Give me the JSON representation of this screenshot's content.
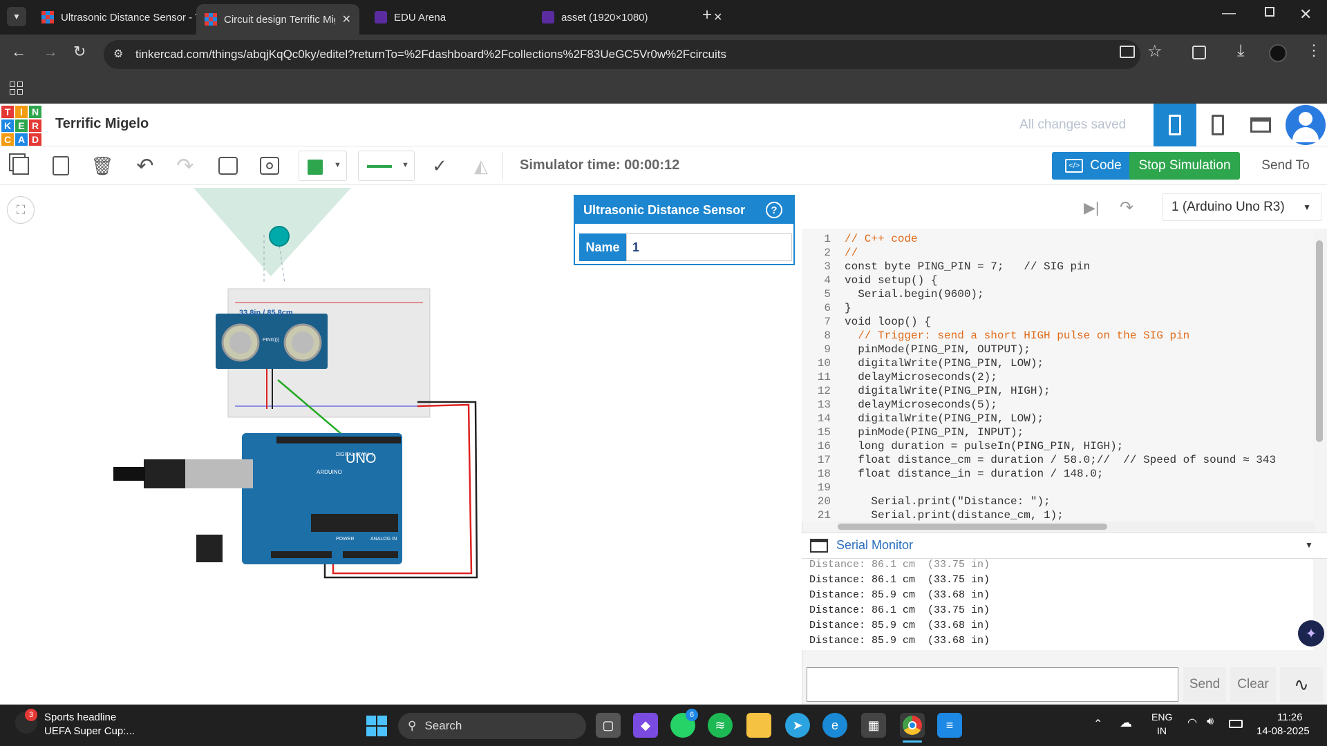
{
  "browser": {
    "tabs": [
      {
        "title": "Ultrasonic Distance Sensor - Tin",
        "icon": "tinkercad-icon"
      },
      {
        "title": "Circuit design Terrific Migelo - T",
        "icon": "tinkercad-icon"
      },
      {
        "title": "EDU Arena",
        "icon": "edu-arena-icon"
      },
      {
        "title": "asset (1920×1080)",
        "icon": "edu-arena-icon"
      }
    ],
    "url": "tinkercad.com/things/abqjKqQc0ky/editel?returnTo=%2Fdashboard%2Fcollections%2F83UeGC5Vr0w%2Fcircuits"
  },
  "app": {
    "logo_letters": [
      "T",
      "I",
      "N",
      "K",
      "E",
      "R",
      "C",
      "A",
      "D"
    ],
    "project_name": "Terrific Migelo",
    "save_status": "All changes saved"
  },
  "toolbar": {
    "simulator_time": "Simulator time: 00:00:12",
    "code_label": "Code",
    "stop_label": "Stop Simulation",
    "send_to_label": "Send To",
    "component_color": "#2ea64d"
  },
  "inspector": {
    "title": "Ultrasonic Distance Sensor",
    "help": "?",
    "name_label": "Name",
    "name_value": "1"
  },
  "circuit": {
    "distance_label": "33.8in / 85.8cm",
    "sensor_label": "PING)))",
    "board_label": "UNO",
    "board_brand": "ARDUINO",
    "digital_label": "DIGITAL (PWM~)",
    "power_label": "POWER",
    "analog_label": "ANALOG IN"
  },
  "code": {
    "device": "1 (Arduino Uno R3)",
    "lines": [
      "// C++ code",
      "//",
      "const byte PING_PIN = 7;   // SIG pin",
      "void setup() {",
      "  Serial.begin(9600);",
      "}",
      "void loop() {",
      "  // Trigger: send a short HIGH pulse on the SIG pin",
      "  pinMode(PING_PIN, OUTPUT);",
      "  digitalWrite(PING_PIN, LOW);",
      "  delayMicroseconds(2);",
      "  digitalWrite(PING_PIN, HIGH);",
      "  delayMicroseconds(5);",
      "  digitalWrite(PING_PIN, LOW);",
      "  pinMode(PING_PIN, INPUT);",
      "  long duration = pulseIn(PING_PIN, HIGH);",
      "  float distance_cm = duration / 58.0;//  // Speed of sound ≈ 343",
      "  float distance_in = duration / 148.0;",
      "",
      "    Serial.print(\"Distance: \");",
      "    Serial.print(distance_cm, 1);",
      ""
    ]
  },
  "serial_monitor": {
    "title": "Serial Monitor",
    "lines": [
      "Distance: 86.1 cm  (33.75 in)",
      "Distance: 85.9 cm  (33.68 in)",
      "Distance: 86.1 cm  (33.75 in)",
      "Distance: 85.9 cm  (33.68 in)",
      "Distance: 85.9 cm  (33.68 in)",
      "Distance: 86.1 cm  (33.75 in)"
    ],
    "send_label": "Send",
    "clear_label": "Clear"
  },
  "taskbar": {
    "news_badge": "3",
    "news_title": "Sports headline",
    "news_sub": "UEFA Super Cup:...",
    "search_label": "Search",
    "whatsapp_badge": "6",
    "lang1": "ENG",
    "lang2": "IN",
    "time": "11:26",
    "date": "14-08-2025"
  }
}
